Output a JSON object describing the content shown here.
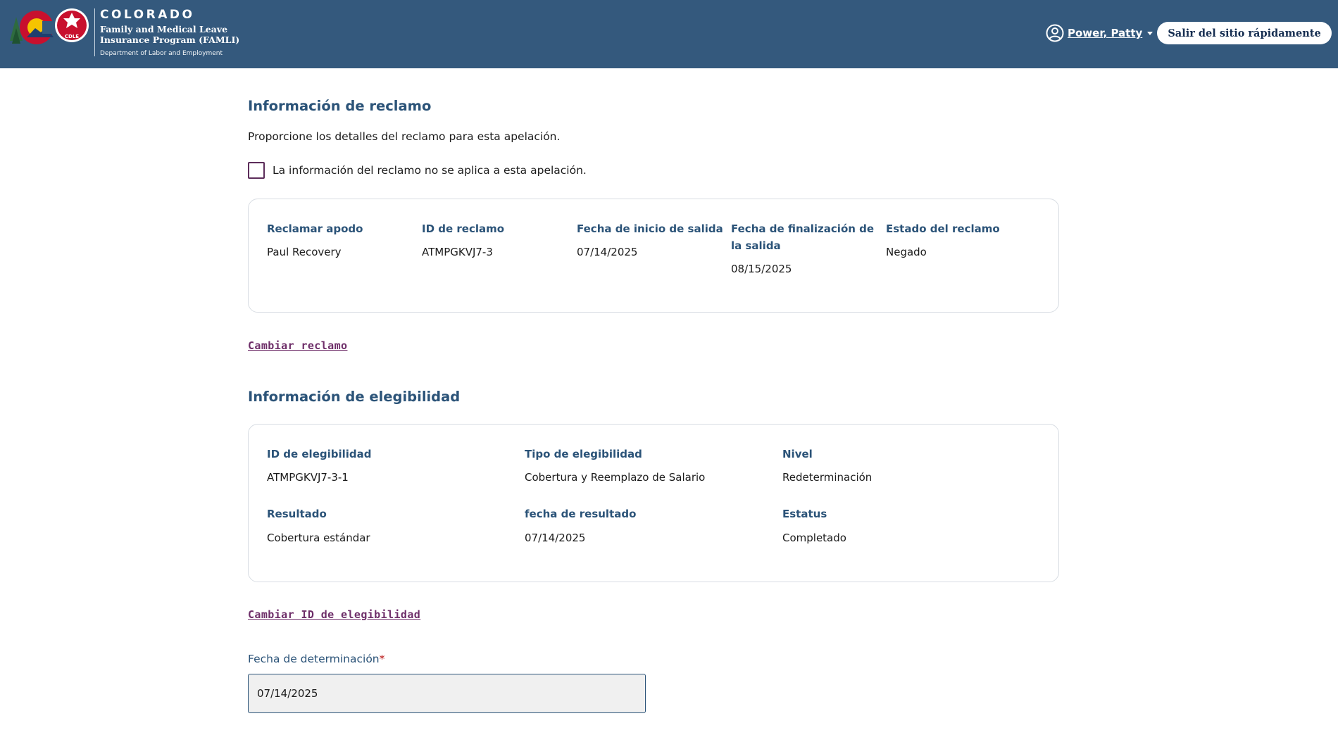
{
  "header": {
    "brand_title": "COLORADO",
    "brand_line1": "Family and Medical Leave",
    "brand_line2": "Insurance Program (FAMLI)",
    "brand_dept": "Department of Labor and Employment",
    "logo_badge": "CDLE",
    "user_name": "Power, Patty",
    "exit_label": "Salir del sitio rápidamente",
    "colors": {
      "header_bg": "#34597d",
      "exit_text": "#162e51"
    }
  },
  "claim_section": {
    "title": "Información de reclamo",
    "intro": "Proporcione los detalles del reclamo para esta apelación.",
    "checkbox_label": "La información del reclamo no se aplica a esta apelación.",
    "fields": [
      {
        "label": "Reclamar apodo",
        "value": "Paul Recovery"
      },
      {
        "label": "ID de reclamo",
        "value": "ATMPGKVJ7-3"
      },
      {
        "label": "Fecha de inicio de salida",
        "value": "07/14/2025"
      },
      {
        "label_line1": "Fecha de finalización de",
        "label_line2": "la salida",
        "value": "08/15/2025"
      },
      {
        "label": "Estado del reclamo",
        "value": "Negado"
      }
    ],
    "change_link": "Cambiar reclamo"
  },
  "eligibility_section": {
    "title": "Información de elegibilidad",
    "fields": [
      {
        "label": "ID de elegibilidad",
        "value": "ATMPGKVJ7-3-1"
      },
      {
        "label": "Tipo de elegibilidad",
        "value": "Cobertura y Reemplazo de Salario"
      },
      {
        "label": "Nivel",
        "value": "Redeterminación"
      },
      {
        "label": "Resultado",
        "value": "Cobertura estándar"
      },
      {
        "label": "fecha de resultado",
        "value": "07/14/2025"
      },
      {
        "label": "Estatus",
        "value": "Completado"
      }
    ],
    "change_link": "Cambiar ID de elegibilidad"
  },
  "determination": {
    "label": "Fecha de determinación",
    "required_mark": "*",
    "value": "07/14/2025"
  },
  "colors": {
    "heading": "#2b5378",
    "link": "#6e2e69",
    "checkbox_border": "#5c2d5a",
    "required": "#b50909"
  }
}
